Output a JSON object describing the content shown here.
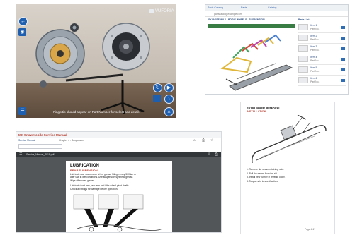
{
  "ar_panel": {
    "brand": "VUFORIA",
    "caption": "Fingertip should appear on Part Number for select and detail.",
    "colors": {
      "button": "#1f5fb0"
    },
    "left_buttons": [
      "back-icon",
      "camera-icon"
    ],
    "right_buttons": [
      "refresh-icon",
      "play-icon",
      "info-icon",
      "next-icon",
      "home-icon"
    ]
  },
  "parts_panel": {
    "tabs": [
      "Parts Catalog - ",
      "Parts ",
      "Catalog"
    ],
    "url": "partscatalog.example.com",
    "breadcrumb": "SKI ASSEMBLY - BOGIE WHEELS - SUSPENSION",
    "header_bar": "Parts List",
    "items": [
      {
        "label": "Item 1",
        "sub": "Part No."
      },
      {
        "label": "Item 2",
        "sub": "Part No."
      },
      {
        "label": "Item 3",
        "sub": "Part No."
      },
      {
        "label": "Item 4",
        "sub": "Part No."
      },
      {
        "label": "Item 5",
        "sub": "Part No."
      },
      {
        "label": "Item 6",
        "sub": "Part No."
      }
    ]
  },
  "manual_panel": {
    "app_title": "MX Snowmobile Service Manual",
    "tab_label": "Service Manual",
    "nav_label": "Chapter 4 - Suspension",
    "pdf_file": "Service_Manual_2018.pdf",
    "page_heading": "LUBRICATION",
    "page_subheading": "REAR SUSPENSION",
    "body_lines": [
      "Lubricate rear suspension at the grease fittings every 500 km or",
      "after use in wet conditions. Use suspension synthetic grease.",
      "Wipe off excess grease."
    ],
    "body_lines_2": [
      "Lubricate front arm, rear arm and idler wheel pivot shafts.",
      "Check all fittings for damage before operation."
    ]
  },
  "doc_panel": {
    "heading": "SKI RUNNER REMOVAL",
    "subheading": "INSTALLATION",
    "steps": [
      "1. Remove ski runner retaining nuts.",
      "2. Pull the runner from the ski.",
      "3. Install new runner in reverse order.",
      "4. Torque nuts to specification."
    ],
    "page_number": "Page 4-17"
  }
}
